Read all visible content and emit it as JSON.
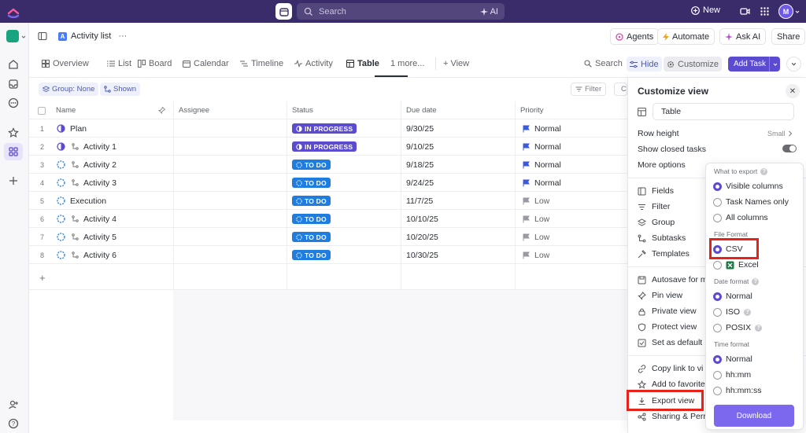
{
  "colors": {
    "topbar": "#3a2c6b",
    "accent": "#7b68ee",
    "in_progress": "#5b4bd1",
    "todo": "#1f7de0",
    "highlight": "#e5231b"
  },
  "topbar": {
    "search_placeholder": "Search",
    "ai_label": "AI",
    "new_label": "New",
    "avatar_initial": "M"
  },
  "header": {
    "breadcrumb_badge": "A",
    "breadcrumb": "Activity list",
    "more": "···",
    "agents": "Agents",
    "automate": "Automate",
    "ask_ai": "Ask AI",
    "share": "Share"
  },
  "tabs": {
    "overview": "Overview",
    "list": "List",
    "board": "Board",
    "calendar": "Calendar",
    "timeline": "Timeline",
    "activity": "Activity",
    "table": "Table",
    "more": "1 more...",
    "add_view": "+ View",
    "search": "Search",
    "hide": "Hide",
    "customize": "Customize",
    "add_task": "Add Task"
  },
  "filters": {
    "group": "Group: None",
    "shown": "Shown",
    "filter": "Filter",
    "closed": "C"
  },
  "table": {
    "headers": {
      "name": "Name",
      "assignee": "Assignee",
      "status": "Status",
      "due": "Due date",
      "priority": "Priority"
    },
    "rows": [
      {
        "num": "1",
        "name": "Plan",
        "sub": false,
        "status": "IN PROGRESS",
        "status_type": "prog",
        "due": "9/30/25",
        "priority": "Normal",
        "pri_type": "normal"
      },
      {
        "num": "2",
        "name": "Activity 1",
        "sub": true,
        "status": "IN PROGRESS",
        "status_type": "prog",
        "due": "9/10/25",
        "priority": "Normal",
        "pri_type": "normal"
      },
      {
        "num": "3",
        "name": "Activity 2",
        "sub": true,
        "status": "TO DO",
        "status_type": "todo",
        "due": "9/18/25",
        "priority": "Normal",
        "pri_type": "normal"
      },
      {
        "num": "4",
        "name": "Activity 3",
        "sub": true,
        "status": "TO DO",
        "status_type": "todo",
        "due": "9/24/25",
        "priority": "Normal",
        "pri_type": "normal"
      },
      {
        "num": "5",
        "name": "Execution",
        "sub": false,
        "status": "TO DO",
        "status_type": "todo",
        "due": "11/7/25",
        "priority": "Low",
        "pri_type": "low"
      },
      {
        "num": "6",
        "name": "Activity 4",
        "sub": true,
        "status": "TO DO",
        "status_type": "todo",
        "due": "10/10/25",
        "priority": "Low",
        "pri_type": "low"
      },
      {
        "num": "7",
        "name": "Activity 5",
        "sub": true,
        "status": "TO DO",
        "status_type": "todo",
        "due": "10/20/25",
        "priority": "Low",
        "pri_type": "low"
      },
      {
        "num": "8",
        "name": "Activity 6",
        "sub": true,
        "status": "TO DO",
        "status_type": "todo",
        "due": "10/30/25",
        "priority": "Low",
        "pri_type": "low"
      }
    ],
    "add_row": "+"
  },
  "panel": {
    "title": "Customize view",
    "close": "✕",
    "view_name": "Table",
    "row_height": "Row height",
    "row_height_value": "Small",
    "show_closed": "Show closed tasks",
    "more_options": "More options",
    "fields": "Fields",
    "filter": "Filter",
    "group": "Group",
    "subtasks": "Subtasks",
    "templates": "Templates",
    "autosave": "Autosave for m",
    "pin": "Pin view",
    "private": "Private view",
    "protect": "Protect view",
    "set_default": "Set as default",
    "copy_link": "Copy link to vi",
    "add_fav": "Add to favorite",
    "export": "Export view",
    "sharing": "Sharing & Perr"
  },
  "export": {
    "what_label": "What to export",
    "visible": "Visible columns",
    "task_names": "Task Names only",
    "all_cols": "All columns",
    "format_label": "File Format",
    "csv": "CSV",
    "excel": "Excel",
    "date_label": "Date format",
    "d_normal": "Normal",
    "d_iso": "ISO",
    "d_posix": "POSIX",
    "time_label": "Time format",
    "t_normal": "Normal",
    "t_hhmm": "hh:mm",
    "t_hhmmss": "hh:mm:ss",
    "download": "Download"
  }
}
